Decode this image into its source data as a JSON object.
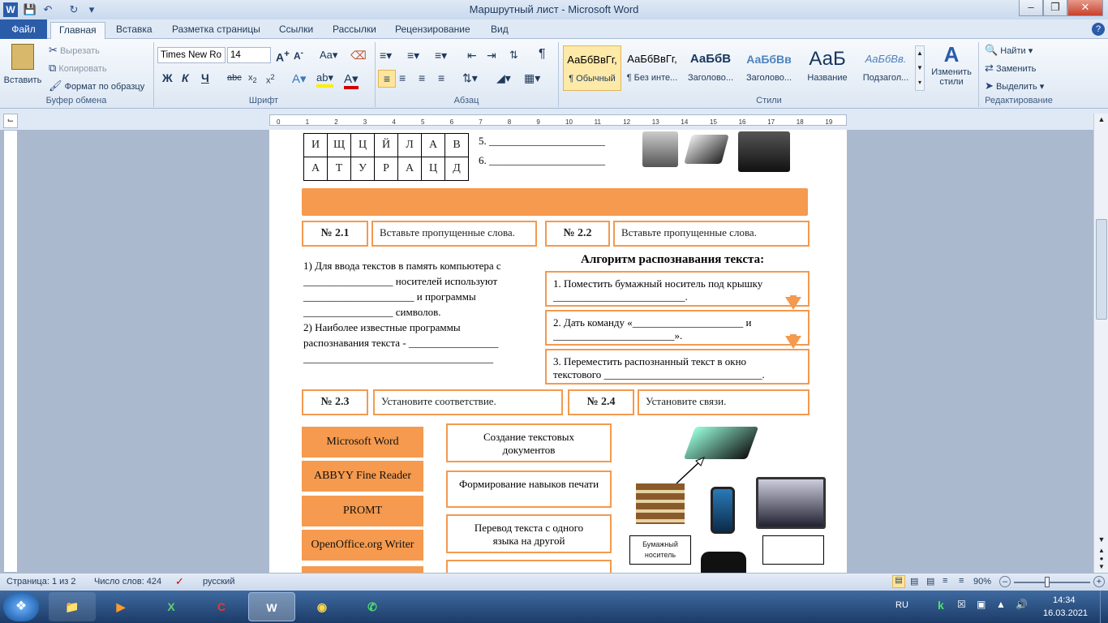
{
  "window": {
    "title": "Маршрутный лист - Microsoft Word"
  },
  "tabs": [
    "Файл",
    "Главная",
    "Вставка",
    "Разметка страницы",
    "Ссылки",
    "Рассылки",
    "Рецензирование",
    "Вид"
  ],
  "ribbon": {
    "clipboard": {
      "paste": "Вставить",
      "cut": "Вырезать",
      "copy": "Копировать",
      "format_painter": "Формат по образцу",
      "label": "Буфер обмена"
    },
    "font": {
      "name": "Times New Ro",
      "size": "14",
      "label": "Шрифт"
    },
    "paragraph": {
      "label": "Абзац"
    },
    "styles": {
      "label": "Стили",
      "items": [
        {
          "sample": "АаБбВвГг,",
          "name": "¶ Обычный"
        },
        {
          "sample": "АаБбВвГг,",
          "name": "¶ Без инте..."
        },
        {
          "sample": "АаБбВ",
          "name": "Заголово..."
        },
        {
          "sample": "АаБбВв",
          "name": "Заголово..."
        },
        {
          "sample": "АаБ",
          "name": "Название"
        },
        {
          "sample": "АаБбВв.",
          "name": "Подзагол..."
        }
      ],
      "change": "Изменить стили"
    },
    "editing": {
      "find": "Найти",
      "replace": "Заменить",
      "select": "Выделить",
      "label": "Редактирование"
    }
  },
  "doc": {
    "letters_row1": [
      "И",
      "Щ",
      "Ц",
      "Й",
      "Л",
      "А",
      "В"
    ],
    "letters_row2": [
      "А",
      "Т",
      "У",
      "Р",
      "А",
      "Ц",
      "Д"
    ],
    "blank5": "5. ______________________",
    "blank6": "6. ______________________",
    "t21_num": "№ 2.1",
    "t21_text": "Вставьте пропущенные слова.",
    "t22_num": "№ 2.2",
    "t22_text": "Вставьте пропущенные слова.",
    "left_text": [
      "1) Для ввода текстов в память компьютера с",
      "_________________ носителей используют",
      "_____________________ и программы",
      "_________________ символов.",
      "2) Наиболее известные программы",
      "распознавания текста - _________________",
      "____________________________________"
    ],
    "algo_title": "Алгоритм распознавания текста:",
    "algo1a": "1. Поместить бумажный носитель под крышку",
    "algo1b": "_________________________.",
    "algo2a": "2. Дать команду «_____________________ и",
    "algo2b": "_______________________».",
    "algo3a": "3. Переместить распознанный текст в окно",
    "algo3b": "текстового ______________________________.",
    "t23_num": "№ 2.3",
    "t23_text": "Установите соответствие.",
    "t24_num": "№ 2.4",
    "t24_text": "Установите связи.",
    "programs": [
      "Microsoft Word",
      "ABBYY Fine Reader",
      "PROMT",
      "OpenOffice.org Writer"
    ],
    "descs": [
      "Создание текстовых документов",
      "Формирование навыков печати",
      "Перевод текста с одного языка на другой"
    ],
    "paper_label": "Бумажный носитель"
  },
  "status": {
    "page": "Страница: 1 из 2",
    "words": "Число слов: 424",
    "lang": "русский",
    "zoom": "90%"
  },
  "tray": {
    "lang": "RU",
    "time": "14:34",
    "date": "16.03.2021"
  }
}
